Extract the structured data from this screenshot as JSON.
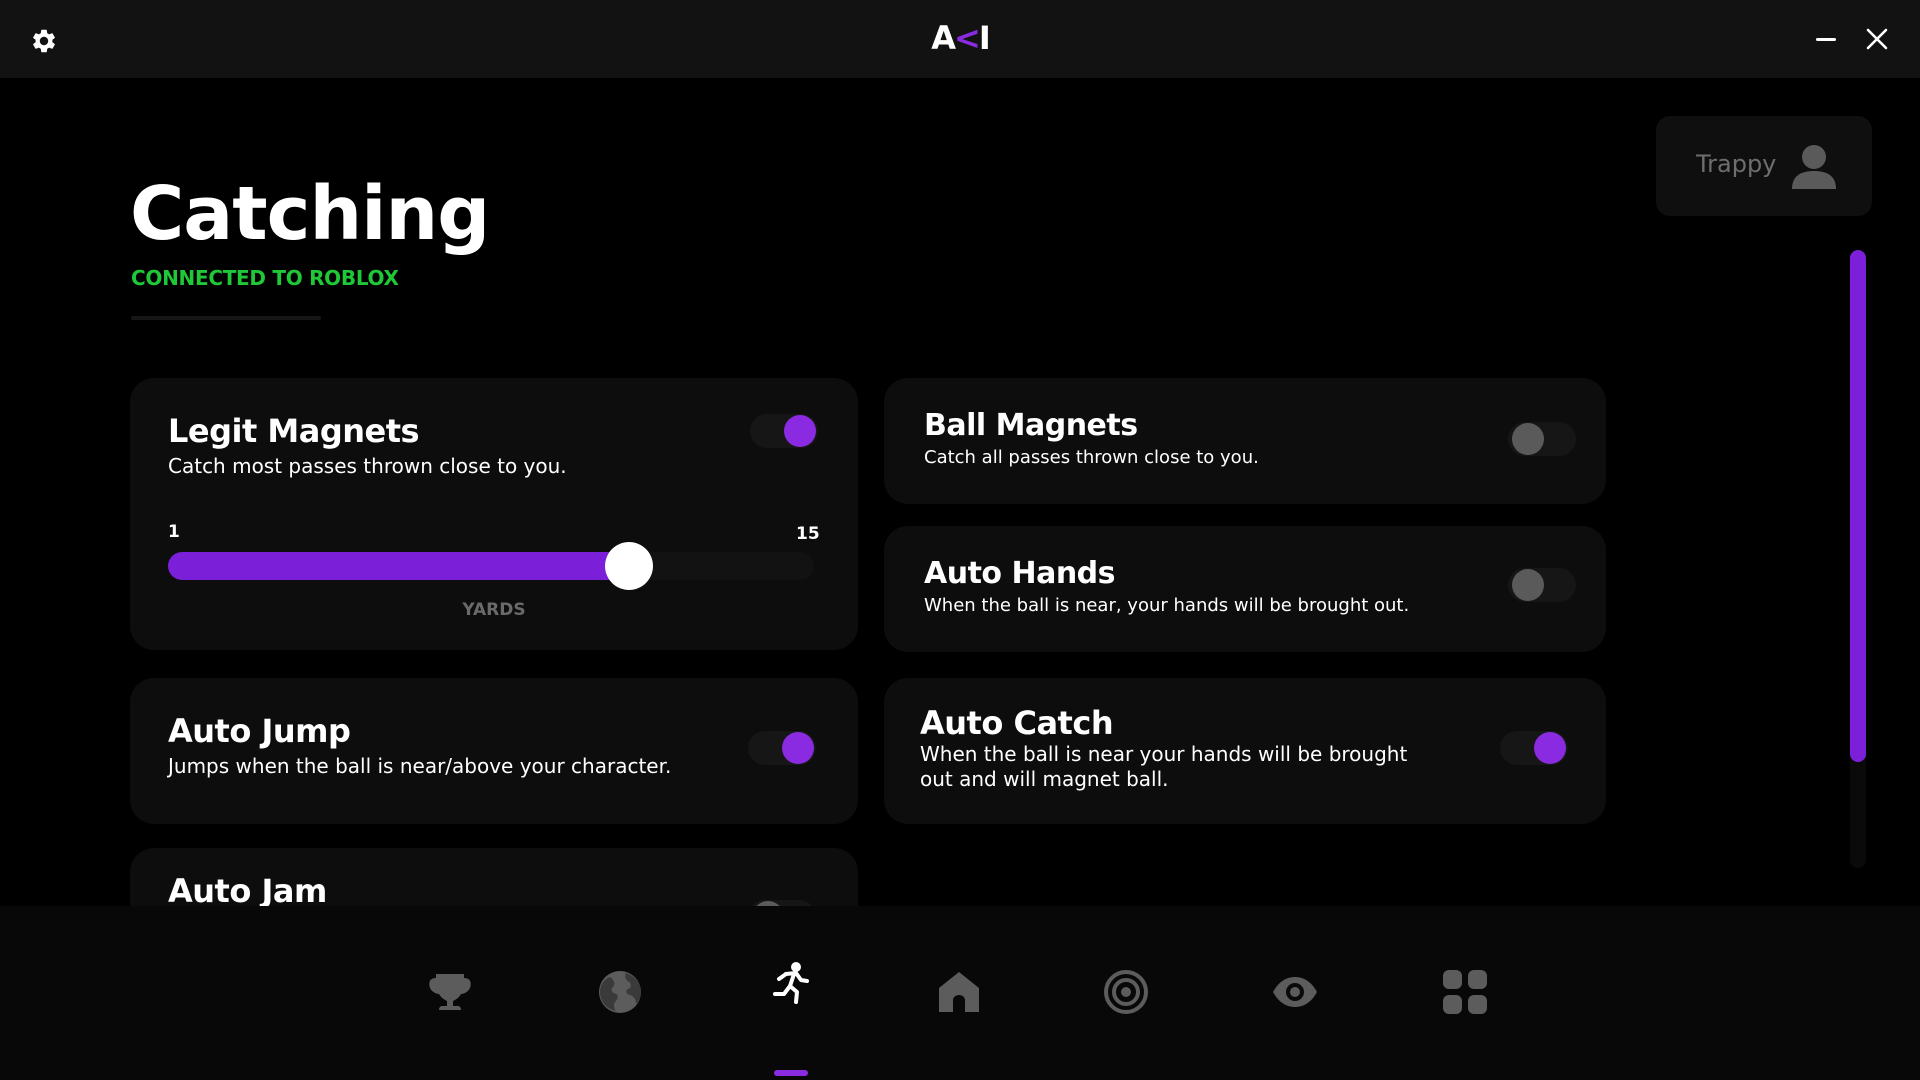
{
  "app": {
    "logo_text": [
      "A",
      "<",
      "I"
    ]
  },
  "page": {
    "title": "Catching",
    "status": "CONNECTED TO ROBLOX"
  },
  "user": {
    "name": "Trappy"
  },
  "cards": {
    "legit_magnets": {
      "title": "Legit Magnets",
      "description": "Catch most passes thrown close to you.",
      "enabled": true,
      "slider": {
        "min": 1,
        "max": 15,
        "min_label": "1",
        "max_label": "15",
        "value": 11,
        "unit": "YARDS"
      }
    },
    "ball_magnets": {
      "title": "Ball Magnets",
      "description": "Catch all passes thrown close to you.",
      "enabled": false
    },
    "auto_hands": {
      "title": "Auto Hands",
      "description": "When the ball is near, your hands will be brought out.",
      "enabled": false
    },
    "auto_jump": {
      "title": "Auto Jump",
      "description": "Jumps when the ball is near/above your character.",
      "enabled": true
    },
    "auto_catch": {
      "title": "Auto Catch",
      "description": "When the ball is near your hands will be brought out and will magnet ball.",
      "enabled": true
    },
    "auto_jam": {
      "title": "Auto Jam"
    }
  },
  "nav": {
    "items": [
      {
        "icon": "trophy-icon",
        "active": false
      },
      {
        "icon": "globe-icon",
        "active": false
      },
      {
        "icon": "running-figure-icon",
        "active": true
      },
      {
        "icon": "home-icon",
        "active": false
      },
      {
        "icon": "target-icon",
        "active": false
      },
      {
        "icon": "eye-icon",
        "active": false
      },
      {
        "icon": "grid-icon",
        "active": false
      }
    ]
  },
  "colors": {
    "accent": "#8a2be2",
    "status_green": "#1ec837",
    "card_bg": "#0d0d0d",
    "toggle_off": "#5a5a5a"
  }
}
